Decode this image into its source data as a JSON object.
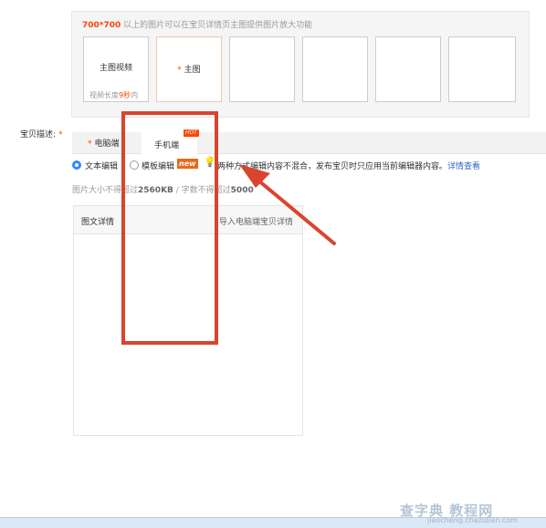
{
  "image_panel": {
    "hint_size": "700*700",
    "hint_text": " 以上的图片可以在宝贝详情页主图提供图片放大功能",
    "slots": [
      {
        "label": "主图视频",
        "note_prefix": "视频长度",
        "note_value": "9秒",
        "note_suffix": "内"
      },
      {
        "label": "主图",
        "required_mark": "*"
      }
    ]
  },
  "description": {
    "label": "宝贝描述:",
    "required_mark": "*"
  },
  "tabs": {
    "pc_star": "*",
    "pc_label": "电脑端",
    "mobile_label": "手机端",
    "hot_badge": "HOT"
  },
  "editor_mode": {
    "text_editor_label": "文本编辑",
    "template_editor_label": "模板编辑",
    "new_badge": "new",
    "bulb_icon": "💡",
    "note_text": "两种方式编辑内容不混合，发布宝贝时只应用当前编辑器内容。",
    "details_link": "详情查看"
  },
  "limits": {
    "prefix": "图片大小不得超过",
    "size": "2560KB",
    "mid": " / 字数不得超过",
    "chars": "5000"
  },
  "editor": {
    "title": "图文详情",
    "import_link": "导入电脑端宝贝详情"
  },
  "watermark": {
    "main": "查字典 教程网",
    "sub": "jiaocheng.chazidian.com"
  },
  "colors": {
    "accent_red": "#d9442f",
    "required": "#ff4400",
    "link": "#3366cc",
    "radio_on": "#3385ff"
  }
}
